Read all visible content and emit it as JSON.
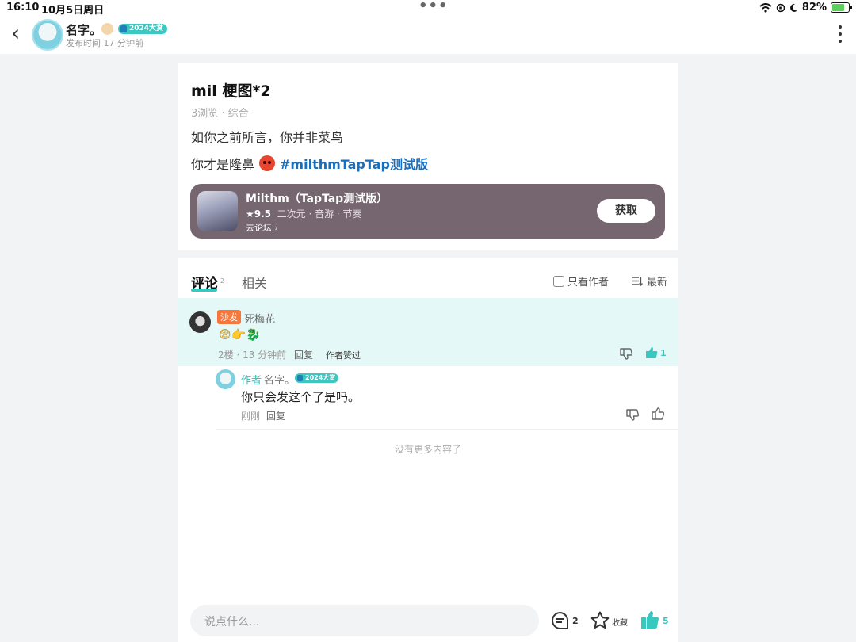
{
  "status_bar": {
    "time": "16:10",
    "date": "10月5日周日",
    "battery": "82%"
  },
  "header": {
    "author": "名字。",
    "badge": "2024大赏",
    "posted": "发布时间 17 分钟前"
  },
  "post": {
    "title": "mil 梗图*2",
    "meta": "3浏览 · 综合",
    "line1": "如你之前所言，你并非菜鸟",
    "line2": "你才是隆鼻",
    "hashtag": "#milthmTapTap测试版",
    "game": {
      "name": "Milthm（TapTap测试版）",
      "rating": "★9.5",
      "tags": "二次元 · 音游 · 节奏",
      "forum": "去论坛",
      "get": "获取"
    }
  },
  "comments": {
    "tab_label": "评论",
    "tab_count": "2",
    "related_label": "相关",
    "author_only": "只看作者",
    "sort": "最新",
    "items": [
      {
        "tag": "沙发",
        "name": "死梅花",
        "content": "😨👉🐉",
        "meta": "2楼 · 13 分钟前",
        "reply": "回复",
        "author_liked": "作者赞过",
        "likes": "1"
      }
    ],
    "reply": {
      "author_tag": "作者",
      "name": "名字。",
      "badge": "2024大赏",
      "content": "你只会发这个了是吗。",
      "time": "刚刚",
      "reply": "回复"
    },
    "no_more": "没有更多内容了"
  },
  "bottom": {
    "placeholder": "说点什么...",
    "comment_count": "2",
    "favorite": "收藏",
    "like_count": "5"
  },
  "colors": {
    "accent": "#37c9c0",
    "hashtag": "#1a6fbd",
    "sofa": "#f6773b",
    "game_card": "#76666f"
  }
}
